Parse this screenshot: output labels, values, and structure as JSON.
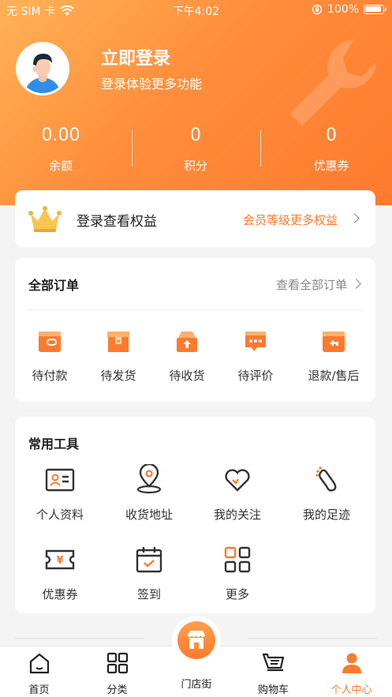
{
  "status_bar": {
    "carrier": "无 SIM 卡",
    "time": "下午4:02",
    "battery": "100%",
    "battery_level": 1.0
  },
  "profile": {
    "login_title": "立即登录",
    "login_subtitle": "登录体验更多功能"
  },
  "stats": [
    {
      "value": "0.00",
      "label": "余额"
    },
    {
      "value": "0",
      "label": "积分"
    },
    {
      "value": "0",
      "label": "优惠券"
    }
  ],
  "member": {
    "text": "登录查看权益",
    "link": "会员等级更多权益"
  },
  "orders": {
    "title": "全部订单",
    "link": "查看全部订单",
    "items": [
      {
        "label": "待付款",
        "icon": "wallet-icon"
      },
      {
        "label": "待发货",
        "icon": "box-icon"
      },
      {
        "label": "待收货",
        "icon": "receive-icon"
      },
      {
        "label": "待评价",
        "icon": "comment-icon"
      },
      {
        "label": "退款/售后",
        "icon": "refund-icon"
      }
    ]
  },
  "tools": {
    "title": "常用工具",
    "items": [
      {
        "label": "个人资料",
        "icon": "id-card-icon"
      },
      {
        "label": "收货地址",
        "icon": "location-icon"
      },
      {
        "label": "我的关注",
        "icon": "heart-icon"
      },
      {
        "label": "我的足迹",
        "icon": "footprint-icon"
      },
      {
        "label": "优惠券",
        "icon": "coupon-icon"
      },
      {
        "label": "签到",
        "icon": "calendar-check-icon"
      },
      {
        "label": "更多",
        "icon": "grid-icon"
      }
    ]
  },
  "tabbar": {
    "items": [
      {
        "label": "首页",
        "icon": "home-icon"
      },
      {
        "label": "分类",
        "icon": "category-icon"
      },
      {
        "label": "门店街",
        "icon": "store-icon"
      },
      {
        "label": "购物车",
        "icon": "cart-icon"
      },
      {
        "label": "个人中心",
        "icon": "user-icon"
      }
    ],
    "active_index": 4
  },
  "colors": {
    "accent": "#ff7a2e",
    "accent_light": "#ffb257",
    "text": "#222222",
    "muted": "#888888"
  }
}
